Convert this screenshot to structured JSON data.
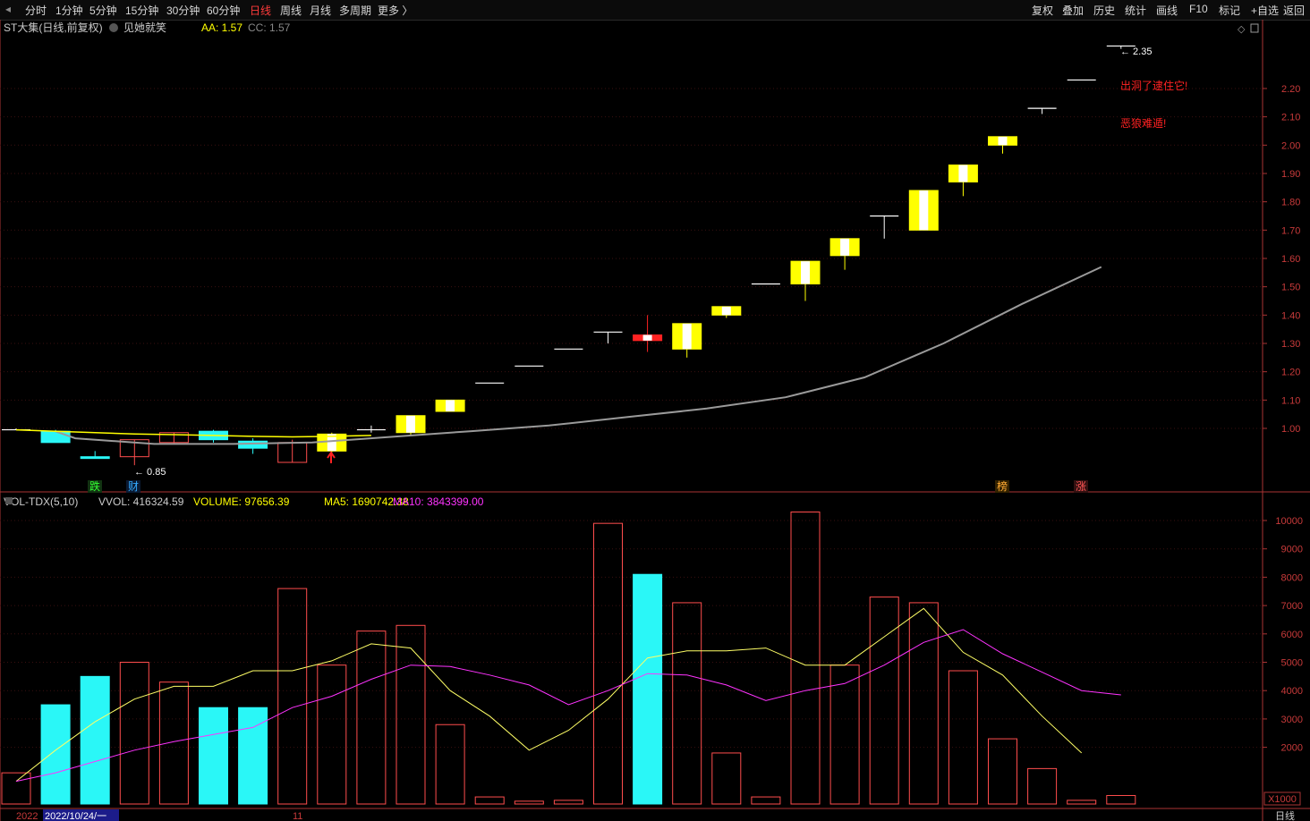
{
  "toolbar": {
    "left": [
      {
        "label": "分时",
        "active": false
      },
      {
        "label": "1分钟",
        "active": false
      },
      {
        "label": "5分钟",
        "active": false
      },
      {
        "label": "15分钟",
        "active": false
      },
      {
        "label": "30分钟",
        "active": false
      },
      {
        "label": "60分钟",
        "active": false
      },
      {
        "label": "日线",
        "active": true
      },
      {
        "label": "周线",
        "active": false
      },
      {
        "label": "月线",
        "active": false
      },
      {
        "label": "多周期",
        "active": false
      },
      {
        "label": "更多 〉",
        "active": false
      }
    ],
    "right": [
      "复权",
      "叠加",
      "历史",
      "统计",
      "画线",
      "F10",
      "标记",
      "+自选",
      "返回"
    ]
  },
  "main_info": {
    "stock": "ST大集(日线,前复权)",
    "indicator": "见她就笑",
    "aa": "AA: 1.57",
    "cc": "CC: 1.57"
  },
  "vol_info": {
    "name": "VOL-TDX(5,10)",
    "vvol": "VVOL: 416324.59",
    "volume": "VOLUME: 97656.39",
    "ma5": "MA5: 1690742.38",
    "ma10": "MA10: 3843399.00"
  },
  "annotations": {
    "high_label": "2.35",
    "low_label": "0.85",
    "text1": "出洞了逮住它!",
    "text2": "恶狼难遁!",
    "marker_die": "跌",
    "marker_cai": "财",
    "marker_bang": "榜",
    "marker_zhang": "涨"
  },
  "bottom": {
    "year_label": "2022",
    "date_label": "2022/10/24/一",
    "month_label": "11",
    "period_label": "日线",
    "unit_label": "X1000"
  },
  "colors": {
    "up": "#ff4d4d",
    "down": "#2af7f7",
    "yellow": "#ffff00",
    "axis": "#c83a3a",
    "ma5": "#ffff66",
    "ma10": "#ff33ff",
    "long_ma": "#9a9a9a"
  },
  "chart_data": [
    {
      "type": "candlestick",
      "title": "ST大集(日线,前复权)",
      "y_ticks": [
        1.0,
        1.1,
        1.2,
        1.3,
        1.4,
        1.5,
        1.6,
        1.7,
        1.8,
        1.9,
        2.0,
        2.1,
        2.2
      ],
      "candles": [
        {
          "o": 0.995,
          "h": 1.0,
          "l": 0.995,
          "c": 0.995,
          "color": "flat"
        },
        {
          "o": 0.99,
          "h": 0.995,
          "l": 0.95,
          "c": 0.95,
          "color": "down"
        },
        {
          "o": 0.9,
          "h": 0.92,
          "l": 0.895,
          "c": 0.9,
          "color": "down"
        },
        {
          "o": 0.9,
          "h": 0.96,
          "l": 0.87,
          "c": 0.96,
          "color": "up"
        },
        {
          "o": 0.95,
          "h": 0.985,
          "l": 0.945,
          "c": 0.985,
          "color": "up"
        },
        {
          "o": 0.99,
          "h": 0.995,
          "l": 0.95,
          "c": 0.96,
          "color": "down"
        },
        {
          "o": 0.955,
          "h": 0.965,
          "l": 0.91,
          "c": 0.93,
          "color": "down"
        },
        {
          "o": 0.88,
          "h": 0.96,
          "l": 0.88,
          "c": 0.95,
          "color": "up"
        },
        {
          "o": 0.92,
          "h": 0.985,
          "l": 0.915,
          "c": 0.98,
          "color": "yellow"
        },
        {
          "o": 0.995,
          "h": 1.01,
          "l": 0.985,
          "c": 0.995,
          "color": "flat"
        },
        {
          "o": 0.985,
          "h": 1.045,
          "l": 0.975,
          "c": 1.045,
          "color": "yellow"
        },
        {
          "o": 1.06,
          "h": 1.1,
          "l": 1.06,
          "c": 1.1,
          "color": "yellow"
        },
        {
          "o": 1.16,
          "h": 1.16,
          "l": 1.16,
          "c": 1.16,
          "color": "flat"
        },
        {
          "o": 1.22,
          "h": 1.22,
          "l": 1.22,
          "c": 1.22,
          "color": "flat"
        },
        {
          "o": 1.28,
          "h": 1.28,
          "l": 1.28,
          "c": 1.28,
          "color": "flat"
        },
        {
          "o": 1.34,
          "h": 1.34,
          "l": 1.3,
          "c": 1.34,
          "color": "flat"
        },
        {
          "o": 1.31,
          "h": 1.4,
          "l": 1.27,
          "c": 1.33,
          "color": "redwhite"
        },
        {
          "o": 1.28,
          "h": 1.37,
          "l": 1.25,
          "c": 1.37,
          "color": "yellow"
        },
        {
          "o": 1.4,
          "h": 1.43,
          "l": 1.39,
          "c": 1.43,
          "color": "yellow"
        },
        {
          "o": 1.51,
          "h": 1.51,
          "l": 1.51,
          "c": 1.51,
          "color": "flat"
        },
        {
          "o": 1.51,
          "h": 1.59,
          "l": 1.45,
          "c": 1.59,
          "color": "yellow"
        },
        {
          "o": 1.61,
          "h": 1.67,
          "l": 1.56,
          "c": 1.67,
          "color": "yellow"
        },
        {
          "o": 1.75,
          "h": 1.75,
          "l": 1.67,
          "c": 1.75,
          "color": "flat"
        },
        {
          "o": 1.7,
          "h": 1.84,
          "l": 1.7,
          "c": 1.84,
          "color": "yellow"
        },
        {
          "o": 1.87,
          "h": 1.93,
          "l": 1.82,
          "c": 1.93,
          "color": "yellow"
        },
        {
          "o": 2.0,
          "h": 2.03,
          "l": 1.97,
          "c": 2.03,
          "color": "yellow"
        },
        {
          "o": 2.13,
          "h": 2.13,
          "l": 2.11,
          "c": 2.13,
          "color": "flat"
        },
        {
          "o": 2.23,
          "h": 2.23,
          "l": 2.23,
          "c": 2.23,
          "color": "flat"
        },
        {
          "o": 2.35,
          "h": 2.35,
          "l": 2.34,
          "c": 2.35,
          "color": "flat"
        }
      ],
      "yellow_line": [
        0.995,
        0.99,
        0.985,
        0.98,
        0.978,
        0.975,
        0.972,
        0.97,
        0.972,
        0.975
      ],
      "long_ma": [
        [
          0.99,
          0.99
        ],
        [
          1.5,
          0.965
        ],
        [
          3.5,
          0.945
        ],
        [
          5.5,
          0.945
        ],
        [
          7.5,
          0.95
        ],
        [
          9.5,
          0.97
        ],
        [
          11.5,
          0.99
        ],
        [
          13.5,
          1.01
        ],
        [
          15.5,
          1.04
        ],
        [
          17.5,
          1.07
        ],
        [
          19.5,
          1.11
        ],
        [
          21.5,
          1.18
        ],
        [
          23.5,
          1.3
        ],
        [
          25.5,
          1.44
        ],
        [
          27.5,
          1.57
        ]
      ]
    },
    {
      "type": "bar",
      "title": "VOL-TDX(5,10)",
      "unit": "X1000",
      "y_ticks": [
        2000,
        3000,
        4000,
        5000,
        6000,
        7000,
        8000,
        9000,
        10000
      ],
      "volumes": [
        1100,
        3500,
        4500,
        5000,
        4300,
        3400,
        3400,
        7600,
        4900,
        6100,
        6300,
        2800,
        250,
        100,
        130,
        9900,
        8100,
        7100,
        1800,
        250,
        10300,
        4900,
        7300,
        7100,
        4700,
        2300,
        1250,
        130,
        300
      ],
      "colors": [
        "up",
        "down",
        "down",
        "up",
        "up",
        "down",
        "down",
        "up",
        "up",
        "up",
        "up",
        "up",
        "up",
        "up",
        "up",
        "up",
        "down",
        "up",
        "up",
        "up",
        "up",
        "up",
        "up",
        "up",
        "up",
        "up",
        "up",
        "up",
        "up"
      ],
      "ma5": [
        800,
        1900,
        2900,
        3700,
        4150,
        4150,
        4700,
        4700,
        5050,
        5650,
        5500,
        4000,
        3100,
        1900,
        2600,
        3700,
        5150,
        5400,
        5400,
        5500,
        4900,
        4900,
        5900,
        6900,
        5350,
        4550,
        3100,
        1800,
        null
      ],
      "ma10": [
        800,
        1100,
        1500,
        1900,
        2200,
        2450,
        2700,
        3400,
        3800,
        4400,
        4900,
        4850,
        4550,
        4200,
        3500,
        4000,
        4600,
        4550,
        4200,
        3650,
        4000,
        4250,
        4900,
        5700,
        6150,
        5300,
        4650,
        4000,
        3850
      ]
    }
  ]
}
